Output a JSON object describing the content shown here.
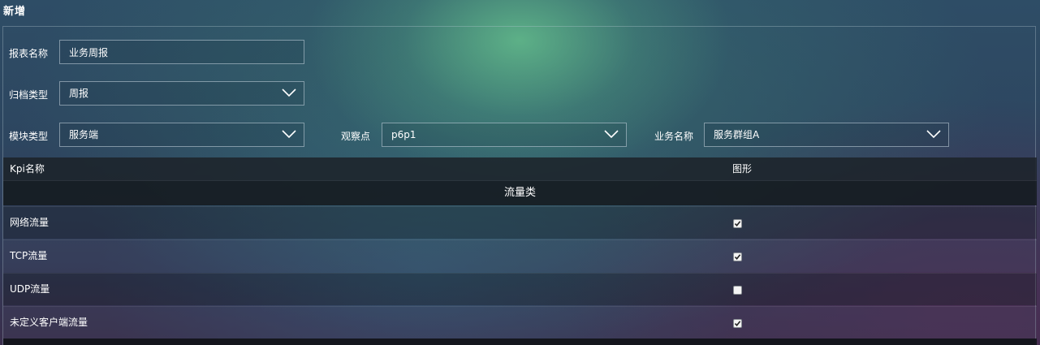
{
  "page": {
    "title": "新增"
  },
  "form": {
    "report_name": {
      "label": "报表名称",
      "value": "业务周报"
    },
    "archive_type": {
      "label": "归档类型",
      "value": "周报"
    },
    "module_type": {
      "label": "模块类型",
      "value": "服务端"
    },
    "observation_point": {
      "label": "观察点",
      "value": "p6p1"
    },
    "business_name": {
      "label": "业务名称",
      "value": "服务群组A"
    }
  },
  "table": {
    "columns": [
      "Kpi名称",
      "图形"
    ],
    "group": "流量类",
    "rows": [
      {
        "name": "网络流量",
        "checked": true
      },
      {
        "name": "TCP流量",
        "checked": true
      },
      {
        "name": "UDP流量",
        "checked": false
      },
      {
        "name": "未定义客户端流量",
        "checked": true
      }
    ]
  },
  "icons": {
    "dropdown": "chevron-down-icon",
    "check": "checkmark-icon"
  }
}
